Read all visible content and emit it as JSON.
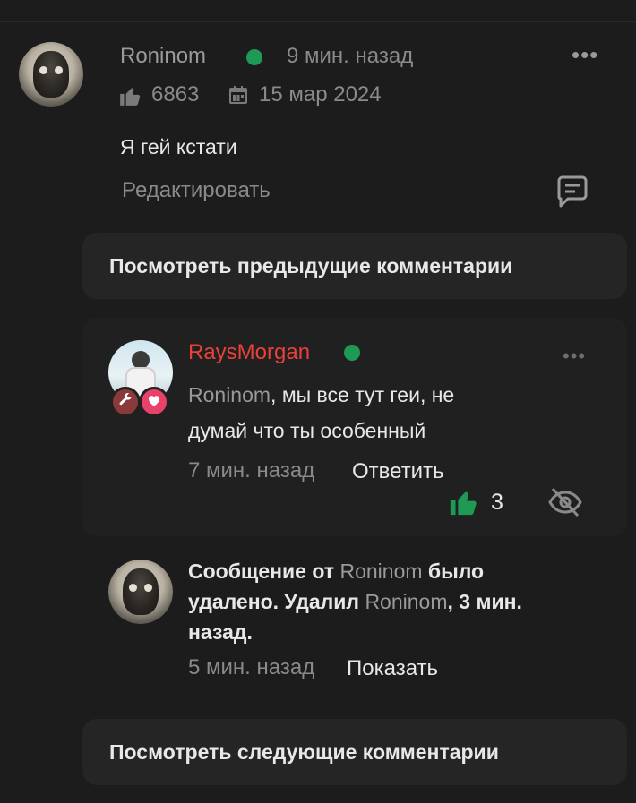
{
  "post": {
    "username": "Roninom",
    "time": "9 мин. назад",
    "likes": "6863",
    "date": "15 мар 2024",
    "text": "Я гей кстати",
    "edit_label": "Редактировать"
  },
  "load_previous_label": "Посмотреть предыдущие комментарии",
  "reply": {
    "username": "RaysMorgan",
    "mention": "Roninom",
    "text_after_mention": ", мы все тут геи, не",
    "text_line2": "думай что ты особенный",
    "time": "7 мин. назад",
    "reply_label": "Ответить",
    "likes": "3"
  },
  "deleted": {
    "line1_prefix": "Сообщение от ",
    "line1_name": "Roninom",
    "line1_suffix": " было",
    "line2_prefix": "удалено. Удалил ",
    "line2_name": "Roninom",
    "line2_suffix": ", 3 мин.",
    "line3": "назад.",
    "time": "5 мин. назад",
    "show_label": "Показать"
  },
  "load_next_label": "Посмотреть следующие комментарии",
  "colors": {
    "online": "#1f9a55",
    "like_active": "#1f9a55",
    "moderator_name": "#e8413b",
    "heart_badge": "#e8416a",
    "wrench_badge": "#8a3a3a"
  },
  "icons": [
    "thumbs-up-icon",
    "calendar-icon",
    "more-icon",
    "reply-comment-icon",
    "wrench-icon",
    "heart-icon",
    "hide-eye-icon"
  ]
}
